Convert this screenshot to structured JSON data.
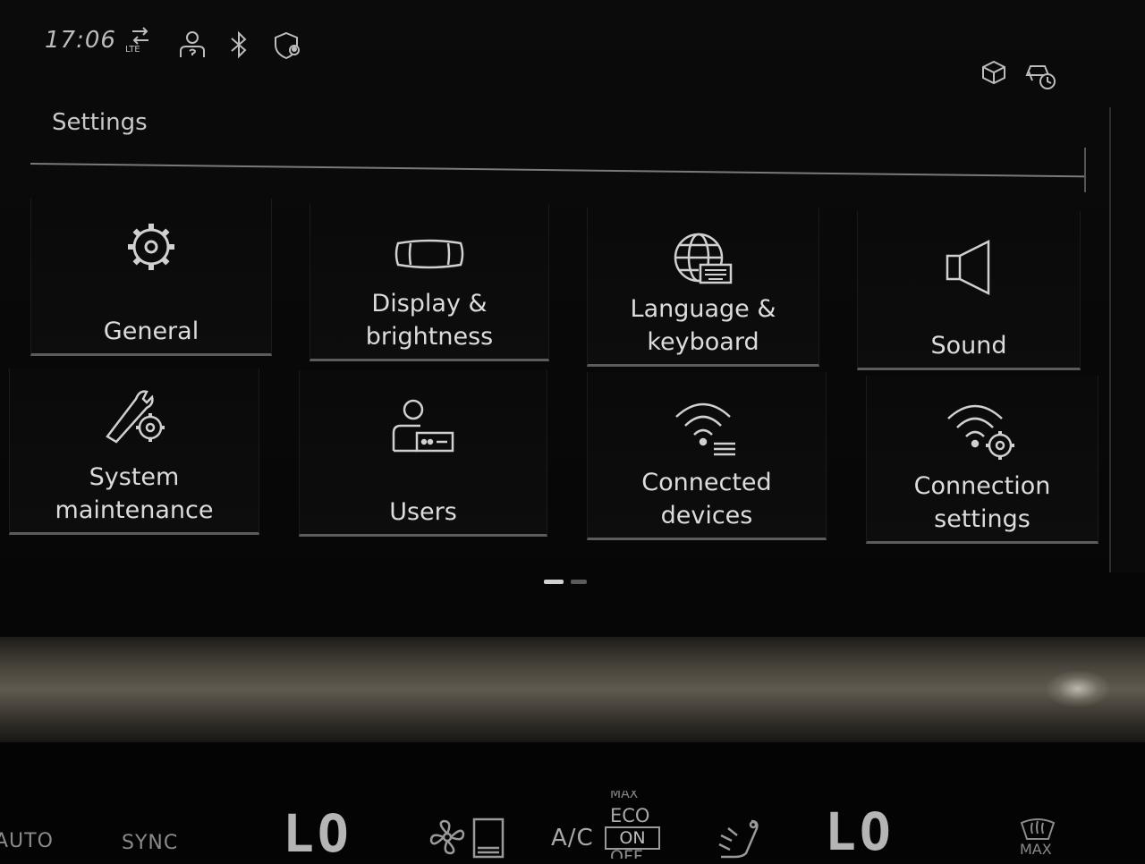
{
  "status_bar": {
    "time": "17:06",
    "network_label": "LTE",
    "icons": [
      "data-transfer-icon",
      "user-unknown-icon",
      "bluetooth-icon",
      "privacy-location-icon",
      "cube-icon",
      "vehicle-timer-icon"
    ]
  },
  "header": {
    "title": "Settings"
  },
  "tiles": [
    {
      "label": "General",
      "icon": "gear-icon"
    },
    {
      "label": "Display &\nbrightness",
      "icon": "display-icon"
    },
    {
      "label": "Language &\nkeyboard",
      "icon": "globe-keyboard-icon"
    },
    {
      "label": "Sound",
      "icon": "speaker-icon"
    },
    {
      "label": "System\nmaintenance",
      "icon": "wrench-gear-icon"
    },
    {
      "label": "Users",
      "icon": "user-card-icon"
    },
    {
      "label": "Connected\ndevices",
      "icon": "wifi-list-icon"
    },
    {
      "label": "Connection\nsettings",
      "icon": "wifi-gear-icon"
    }
  ],
  "pagination": {
    "pages": 2,
    "current": 1
  },
  "climate": {
    "auto_label": "AUTO",
    "sync_label": "SYNC",
    "left_temp": "LO",
    "ac_label": "A/C",
    "max_label_top": "MAX",
    "eco_label": "ECO",
    "on_label": "ON",
    "off_label": "OFF",
    "right_temp": "LO",
    "defrost_max_label": "MAX"
  },
  "colors": {
    "screen_bg": "#080808",
    "text": "#dcdcdc",
    "tile_border": "#5c5c5c",
    "active_dot": "#d0d0d0",
    "inactive_dot": "#5a5a5a"
  }
}
